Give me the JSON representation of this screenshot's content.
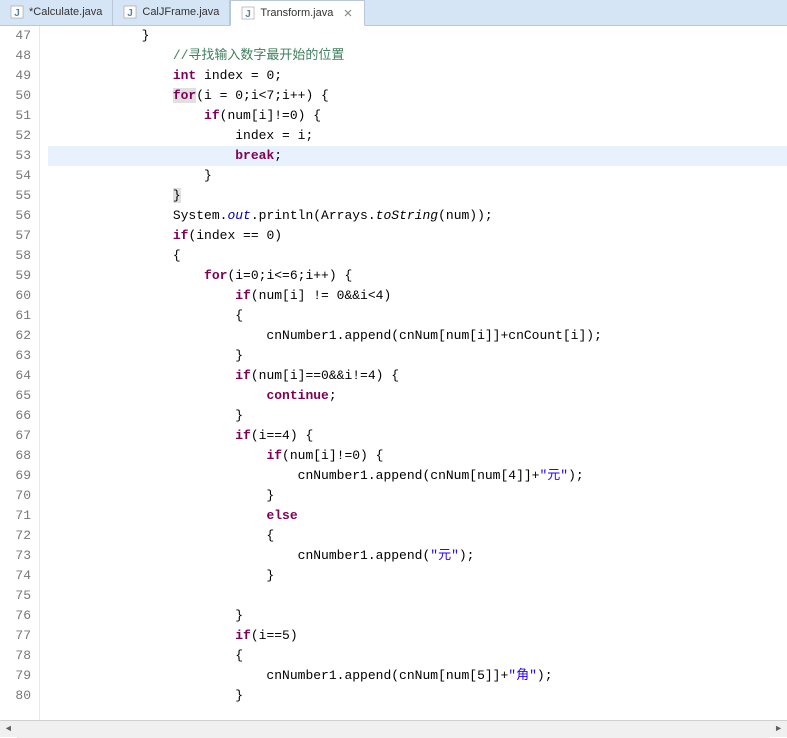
{
  "tabs": [
    {
      "label": "*Calculate.java",
      "active": false
    },
    {
      "label": "CalJFrame.java",
      "active": false
    },
    {
      "label": "Transform.java",
      "active": true
    }
  ],
  "gutter": {
    "start": 47,
    "end": 80
  },
  "highlight_line": 53,
  "code_lines": [
    {
      "n": 47,
      "segs": [
        {
          "t": "            }",
          "c": ""
        }
      ]
    },
    {
      "n": 48,
      "segs": [
        {
          "t": "                ",
          "c": ""
        },
        {
          "t": "//寻找输入数字最开始的位置",
          "c": "cm"
        }
      ]
    },
    {
      "n": 49,
      "segs": [
        {
          "t": "                ",
          "c": ""
        },
        {
          "t": "int",
          "c": "kw"
        },
        {
          "t": " index = 0;",
          "c": ""
        }
      ]
    },
    {
      "n": 50,
      "segs": [
        {
          "t": "                ",
          "c": ""
        },
        {
          "t": "for",
          "c": "kw",
          "bh": true
        },
        {
          "t": "(i = 0;i<7;i++) {",
          "c": ""
        }
      ]
    },
    {
      "n": 51,
      "segs": [
        {
          "t": "                    ",
          "c": ""
        },
        {
          "t": "if",
          "c": "kw"
        },
        {
          "t": "(num[i]!=0) {",
          "c": ""
        }
      ]
    },
    {
      "n": 52,
      "segs": [
        {
          "t": "                        index = i;",
          "c": ""
        }
      ]
    },
    {
      "n": 53,
      "segs": [
        {
          "t": "                        ",
          "c": ""
        },
        {
          "t": "break",
          "c": "kw"
        },
        {
          "t": ";",
          "c": ""
        }
      ]
    },
    {
      "n": 54,
      "segs": [
        {
          "t": "                    }",
          "c": ""
        }
      ]
    },
    {
      "n": 55,
      "segs": [
        {
          "t": "                ",
          "c": ""
        },
        {
          "t": "}",
          "c": "",
          "bh": true
        }
      ]
    },
    {
      "n": 56,
      "segs": [
        {
          "t": "                System.",
          "c": ""
        },
        {
          "t": "out",
          "c": "fi"
        },
        {
          "t": ".println(Arrays.",
          "c": ""
        },
        {
          "t": "toString",
          "c": "mi"
        },
        {
          "t": "(num));",
          "c": ""
        }
      ]
    },
    {
      "n": 57,
      "segs": [
        {
          "t": "                ",
          "c": ""
        },
        {
          "t": "if",
          "c": "kw"
        },
        {
          "t": "(index == 0)",
          "c": ""
        }
      ]
    },
    {
      "n": 58,
      "segs": [
        {
          "t": "                {",
          "c": ""
        }
      ]
    },
    {
      "n": 59,
      "segs": [
        {
          "t": "                    ",
          "c": ""
        },
        {
          "t": "for",
          "c": "kw"
        },
        {
          "t": "(i=0;i<=6;i++) {",
          "c": ""
        }
      ]
    },
    {
      "n": 60,
      "segs": [
        {
          "t": "                        ",
          "c": ""
        },
        {
          "t": "if",
          "c": "kw"
        },
        {
          "t": "(num[i] != 0&&i<4)",
          "c": ""
        }
      ]
    },
    {
      "n": 61,
      "segs": [
        {
          "t": "                        {",
          "c": ""
        }
      ]
    },
    {
      "n": 62,
      "segs": [
        {
          "t": "                            cnNumber1.append(cnNum[num[i]]+cnCount[i]);",
          "c": ""
        }
      ]
    },
    {
      "n": 63,
      "segs": [
        {
          "t": "                        }",
          "c": ""
        }
      ]
    },
    {
      "n": 64,
      "segs": [
        {
          "t": "                        ",
          "c": ""
        },
        {
          "t": "if",
          "c": "kw"
        },
        {
          "t": "(num[i]==0&&i!=4) {",
          "c": ""
        }
      ]
    },
    {
      "n": 65,
      "segs": [
        {
          "t": "                            ",
          "c": ""
        },
        {
          "t": "continue",
          "c": "kw"
        },
        {
          "t": ";",
          "c": ""
        }
      ]
    },
    {
      "n": 66,
      "segs": [
        {
          "t": "                        }",
          "c": ""
        }
      ]
    },
    {
      "n": 67,
      "segs": [
        {
          "t": "                        ",
          "c": ""
        },
        {
          "t": "if",
          "c": "kw"
        },
        {
          "t": "(i==4) {",
          "c": ""
        }
      ]
    },
    {
      "n": 68,
      "segs": [
        {
          "t": "                            ",
          "c": ""
        },
        {
          "t": "if",
          "c": "kw"
        },
        {
          "t": "(num[i]!=0) {",
          "c": ""
        }
      ]
    },
    {
      "n": 69,
      "segs": [
        {
          "t": "                                cnNumber1.append(cnNum[num[4]]+",
          "c": ""
        },
        {
          "t": "\"元\"",
          "c": "st"
        },
        {
          "t": ");",
          "c": ""
        }
      ]
    },
    {
      "n": 70,
      "segs": [
        {
          "t": "                            }",
          "c": ""
        }
      ]
    },
    {
      "n": 71,
      "segs": [
        {
          "t": "                            ",
          "c": ""
        },
        {
          "t": "else",
          "c": "kw"
        }
      ]
    },
    {
      "n": 72,
      "segs": [
        {
          "t": "                            {",
          "c": ""
        }
      ]
    },
    {
      "n": 73,
      "segs": [
        {
          "t": "                                cnNumber1.append(",
          "c": ""
        },
        {
          "t": "\"元\"",
          "c": "st"
        },
        {
          "t": ");",
          "c": ""
        }
      ]
    },
    {
      "n": 74,
      "segs": [
        {
          "t": "                            }",
          "c": ""
        }
      ]
    },
    {
      "n": 75,
      "segs": [
        {
          "t": "",
          "c": ""
        }
      ]
    },
    {
      "n": 76,
      "segs": [
        {
          "t": "                        }",
          "c": ""
        }
      ]
    },
    {
      "n": 77,
      "segs": [
        {
          "t": "                        ",
          "c": ""
        },
        {
          "t": "if",
          "c": "kw"
        },
        {
          "t": "(i==5)",
          "c": ""
        }
      ]
    },
    {
      "n": 78,
      "segs": [
        {
          "t": "                        {",
          "c": ""
        }
      ]
    },
    {
      "n": 79,
      "segs": [
        {
          "t": "                            cnNumber1.append(cnNum[num[5]]+",
          "c": ""
        },
        {
          "t": "\"角\"",
          "c": "st"
        },
        {
          "t": ");",
          "c": ""
        }
      ]
    },
    {
      "n": 80,
      "segs": [
        {
          "t": "                        }",
          "c": ""
        }
      ]
    }
  ]
}
